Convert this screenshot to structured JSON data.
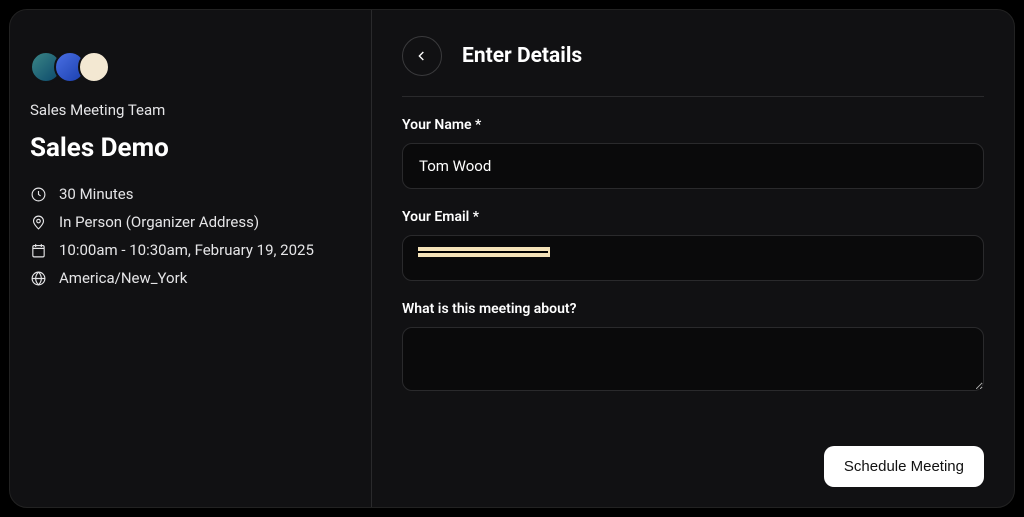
{
  "sidebar": {
    "team_name": "Sales Meeting Team",
    "event_title": "Sales Demo",
    "duration": "30 Minutes",
    "location": "In Person (Organizer Address)",
    "time_slot": "10:00am - 10:30am, February 19, 2025",
    "timezone": "America/New_York"
  },
  "header": {
    "title": "Enter Details"
  },
  "form": {
    "name_label": "Your Name *",
    "name_value": "Tom Wood",
    "email_label": "Your Email *",
    "email_value": "",
    "about_label": "What is this meeting about?",
    "about_value": ""
  },
  "buttons": {
    "schedule": "Schedule Meeting"
  }
}
